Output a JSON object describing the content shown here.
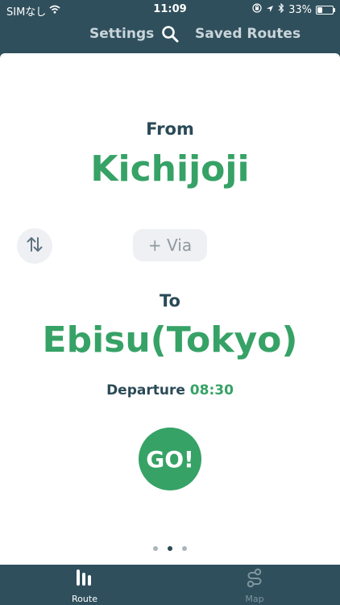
{
  "status_bar": {
    "carrier": "SIMなし",
    "time": "11:09",
    "battery": "33%",
    "battery_level": 0.33
  },
  "nav": {
    "settings_label": "Settings",
    "saved_routes_label": "Saved Routes",
    "search_icon": "search-icon"
  },
  "route": {
    "from_label": "From",
    "from_station": "Kichijoji",
    "via_label": "+ Via",
    "to_label": "To",
    "to_station": "Ebisu(Tokyo)",
    "departure_label": "Departure",
    "departure_time": "08:30",
    "go_label": "GO!"
  },
  "pager": {
    "count": 3,
    "active_index": 1
  },
  "tabs": [
    {
      "label": "Route",
      "icon": "route-icon",
      "active": true
    },
    {
      "label": "Map",
      "icon": "map-icon",
      "active": false
    }
  ],
  "colors": {
    "bar_bg": "#2f4f5c",
    "accent_green": "#36a266",
    "dark_text": "#2b4a57"
  }
}
